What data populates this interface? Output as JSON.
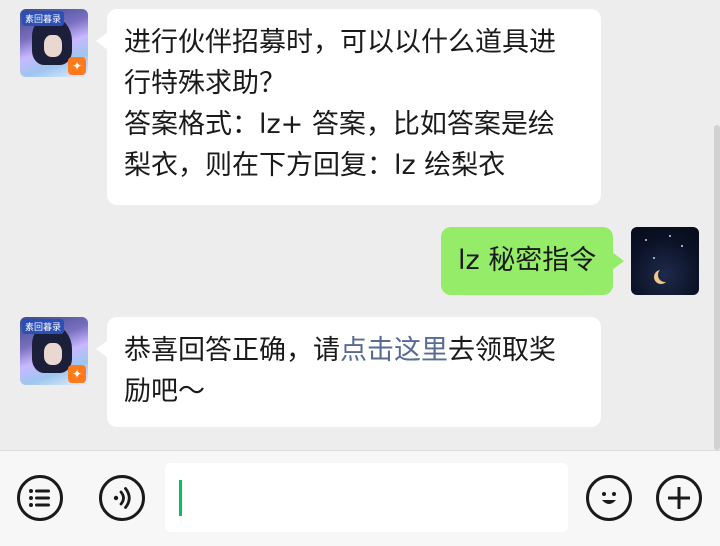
{
  "messages": [
    {
      "side": "left",
      "sender": "game-account",
      "lines": [
        "进行伙伴招募时，可以以什么道具进",
        "行特殊求助？",
        "答案格式：lz+ 答案，比如答案是绘",
        "梨衣，则在下方回复：lz 绘梨衣"
      ]
    },
    {
      "side": "right",
      "sender": "me",
      "text": "lz 秘密指令"
    },
    {
      "side": "left",
      "sender": "game-account",
      "line1_before": "恭喜回答正确，请",
      "line1_link": "点击这里",
      "line1_after": "去领取奖",
      "line2": "励吧～"
    }
  ],
  "avatar": {
    "game_badge": "素回暮录"
  },
  "input": {
    "value": ""
  },
  "colors": {
    "chat_bg": "#ededed",
    "bubble_left": "#ffffff",
    "bubble_right": "#95ec69",
    "link": "#576b95",
    "caret": "#07c160"
  },
  "icons": [
    "list-icon",
    "voice-icon",
    "emoji-icon",
    "plus-icon"
  ]
}
